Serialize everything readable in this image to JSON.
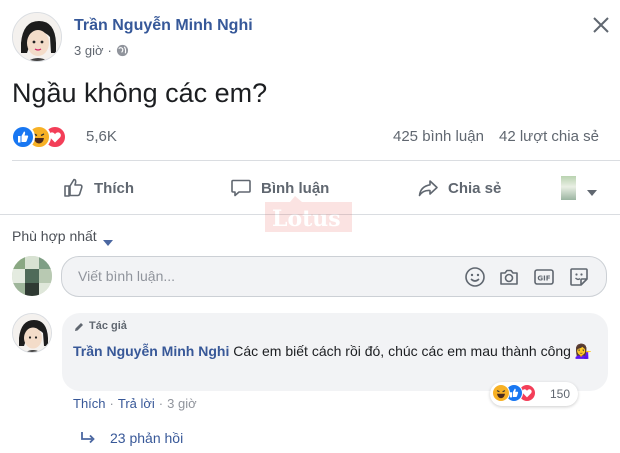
{
  "post": {
    "author": "Trần Nguyễn Minh Nghi",
    "time": "3 giờ",
    "privacy_icon": "globe-icon",
    "text": "Ngầu không các em?",
    "reactions_count": "5,6K",
    "comments_count": "425 bình luận",
    "shares_count": "42 lượt chia sẻ"
  },
  "actions": {
    "like": "Thích",
    "comment": "Bình luận",
    "share": "Chia sẻ"
  },
  "comments_section": {
    "sort_label": "Phù hợp nhất",
    "input_placeholder": "Viết bình luận..."
  },
  "comment": {
    "badge": "Tác giả",
    "author": "Trần Nguyễn Minh Nghi",
    "text": "Các em biết cách rồi đó, chúc các em mau thành công",
    "emoji": "💁‍♀️",
    "like_link": "Thích",
    "reply_link": "Trả lời",
    "time": "3 giờ",
    "reactions_count": "150",
    "replies_label": "23 phản hồi"
  },
  "watermark": "Lotus",
  "colors": {
    "link_blue": "#365899",
    "like_blue": "#1877f2",
    "love_red": "#f33e58",
    "haha_yellow": "#f7b125",
    "gray_text": "#606770"
  }
}
